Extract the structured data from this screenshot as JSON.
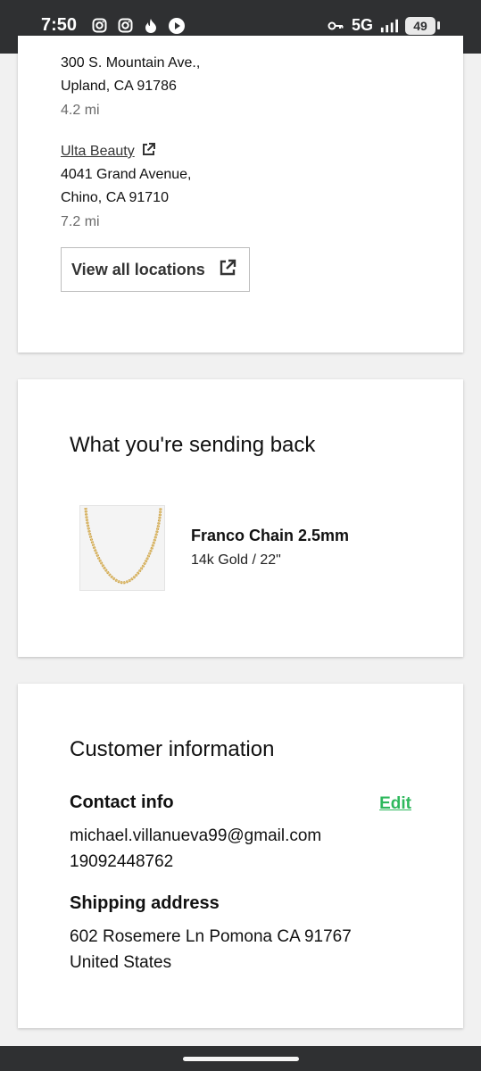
{
  "status_bar": {
    "time": "7:50",
    "icons": [
      "instagram-icon",
      "instagram-icon",
      "fire-icon",
      "play-icon"
    ],
    "network": "5G",
    "battery": "49"
  },
  "locations": {
    "first_store": {
      "address_line1": "300 S. Mountain Ave.,",
      "address_line2": "Upland, CA 91786",
      "distance": "4.2 mi"
    },
    "second_store": {
      "name": "Ulta Beauty",
      "address_line1": "4041 Grand Avenue,",
      "address_line2": "Chino, CA 91710",
      "distance": "7.2 mi"
    },
    "view_all_label": "View all locations"
  },
  "return_items": {
    "title": "What you're sending back",
    "product": {
      "name": "Franco Chain 2.5mm",
      "variant": "14k Gold / 22\""
    }
  },
  "customer": {
    "title": "Customer information",
    "contact_heading": "Contact info",
    "edit_label": "Edit",
    "email": "michael.villanueva99@gmail.com",
    "phone": "19092448762",
    "shipping_heading": "Shipping address",
    "address_line1": "602 Rosemere Ln Pomona CA 91767",
    "country": "United States"
  },
  "colors": {
    "accent_green": "#2eb85c",
    "system_bar": "#2f3032"
  }
}
